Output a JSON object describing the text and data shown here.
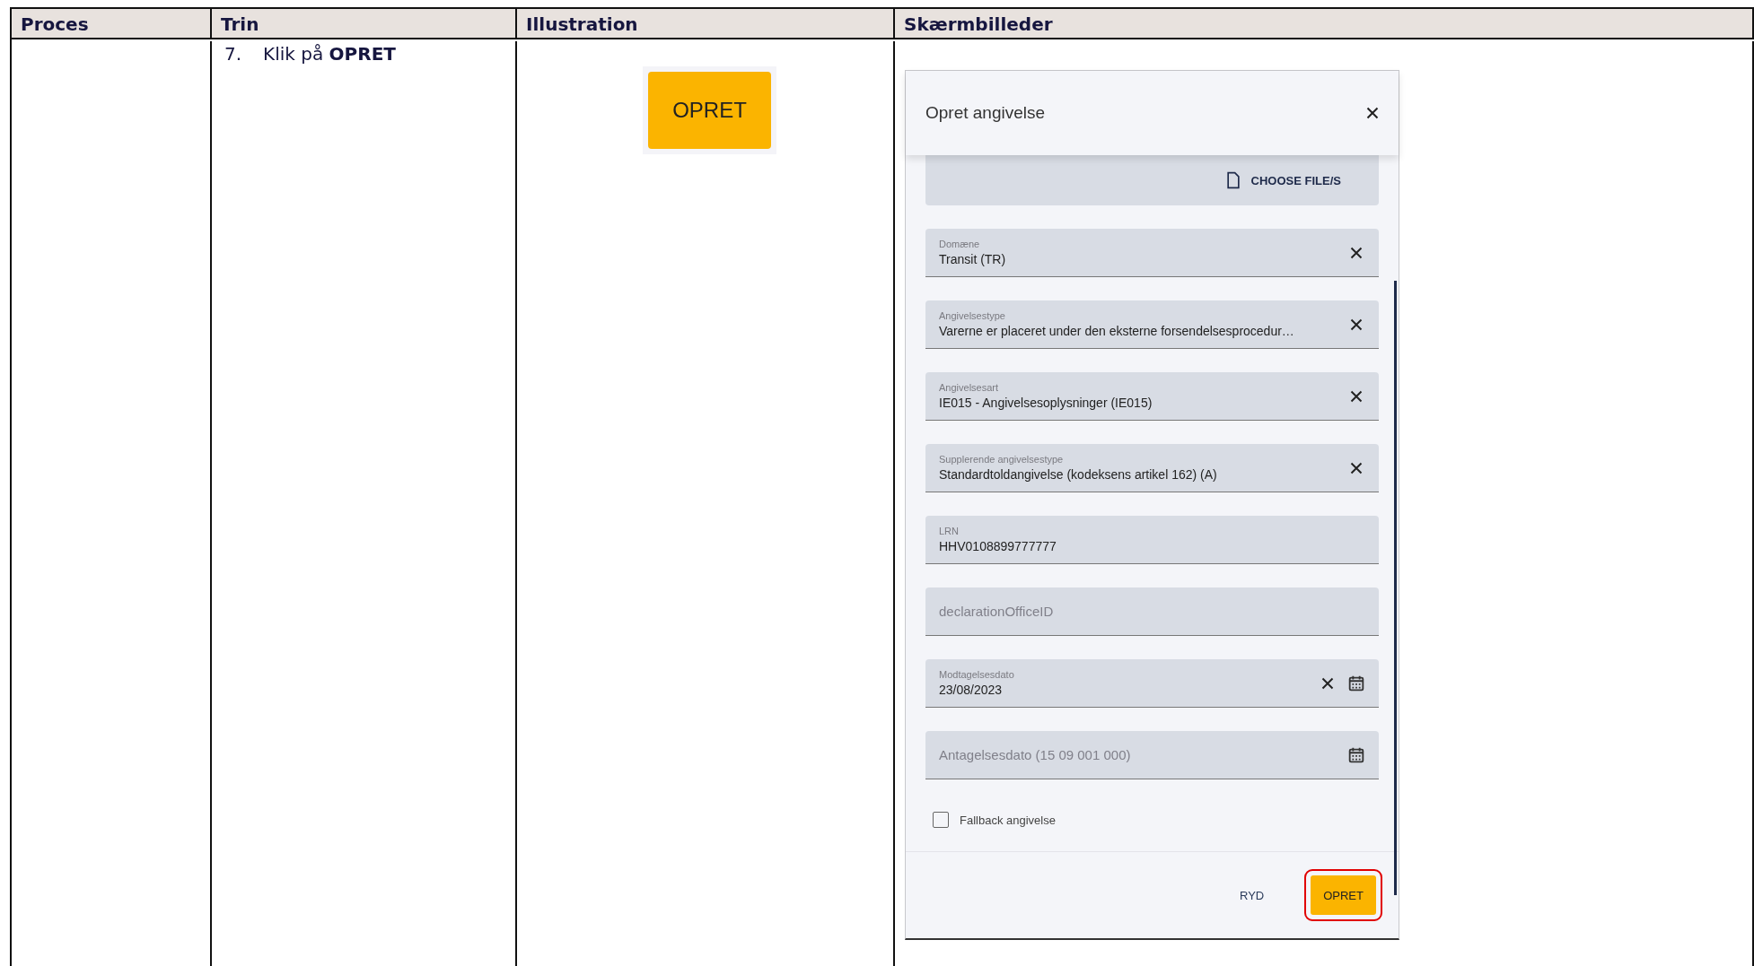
{
  "table": {
    "columns": [
      "Proces",
      "Trin",
      "Illustration",
      "Skærmbilleder"
    ],
    "rows": [
      {
        "process": "",
        "step": {
          "number": "7.",
          "text": "Klik på **OPRET**"
        },
        "illustration": {
          "button": "OPRET"
        },
        "screenshot": {
          "dialog": {
            "title": "Opret angivelse",
            "file_button": "CHOOSE FILE/S",
            "fields": [
              {
                "kind": "select",
                "label": "Domæne",
                "value": "Transit (TR)"
              },
              {
                "kind": "select",
                "label": "Angivelsestype",
                "value": "Varerne er placeret under den eksterne forsendelsesprocedur…"
              },
              {
                "kind": "select",
                "label": "Angivelsesart",
                "value": "IE015 - Angivelsesoplysninger (IE015)"
              },
              {
                "kind": "select",
                "label": "Supplerende angivelsestype",
                "value": "Standardtoldangivelse (kodeksens artikel 162) (A)"
              },
              {
                "kind": "text",
                "label": "LRN",
                "value": "HHV0108899777777"
              },
              {
                "kind": "text",
                "placeholder": "declarationOfficeID"
              },
              {
                "kind": "date",
                "label": "Modtagelsesdato",
                "value": "23/08/2023"
              },
              {
                "kind": "date",
                "placeholder": "Antagelsesdato (15 09 001 000)"
              }
            ],
            "checkbox": {
              "label": "Fallback angivelse",
              "checked": false
            },
            "buttons": [
              {
                "kind": "text",
                "label": "RYD",
                "highlighted": false
              },
              {
                "kind": "primary",
                "label": "OPRET",
                "highlighted": true
              }
            ]
          }
        }
      }
    ]
  }
}
